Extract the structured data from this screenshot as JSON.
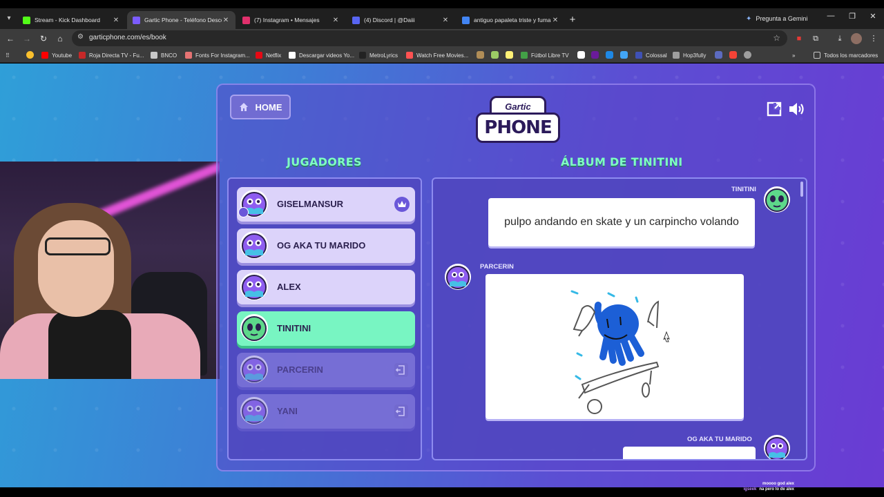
{
  "browser": {
    "tabs": [
      {
        "title": "Stream - Kick Dashboard",
        "icon": "kick-icon",
        "color": "#53fc18",
        "active": false
      },
      {
        "title": "Gartic Phone - Teléfono Descon",
        "icon": "gartic-icon",
        "color": "#7b5cff",
        "active": true
      },
      {
        "title": "(7) Instagram • Mensajes",
        "icon": "instagram-icon",
        "color": "#e1306c",
        "active": false
      },
      {
        "title": "(4) Discord | @Daiii",
        "icon": "discord-icon",
        "color": "#5865f2",
        "active": false
      },
      {
        "title": "antiguo papaleta triste y fuman",
        "icon": "google-icon",
        "color": "#4285f4",
        "active": false
      }
    ],
    "gemini_label": "Pregunta a Gemini",
    "url": "garticphone.com/es/book",
    "bookmarks": [
      {
        "label": "Youtube",
        "icon": "youtube-icon",
        "color": "#ff0000"
      },
      {
        "label": "Roja Directa TV - Fu...",
        "icon": "rojadirecta-icon",
        "color": "#c62828"
      },
      {
        "label": "BNCO",
        "icon": "folder-icon",
        "color": "#c8c8c8"
      },
      {
        "label": "Fonts For Instagram...",
        "icon": "fonts-icon",
        "color": "#e57373"
      },
      {
        "label": "Netflix",
        "icon": "netflix-icon",
        "color": "#e50914"
      },
      {
        "label": "Descargar videos Yo...",
        "icon": "download-icon",
        "color": "#ffffff"
      },
      {
        "label": "MetroLyrics",
        "icon": "metrolyrics-icon",
        "color": "#222222"
      },
      {
        "label": "Watch Free Movies...",
        "icon": "movies-icon",
        "color": "#ff5252"
      },
      {
        "label": "Fútbol Libre TV",
        "icon": "futbol-icon",
        "color": "#43a047"
      },
      {
        "label": "Colossal",
        "icon": "colossal-icon",
        "color": "#3f51b5"
      },
      {
        "label": "Hop3fully",
        "icon": "hop3fully-icon",
        "color": "#9e9e9e"
      }
    ],
    "all_bookmarks_label": "Todos los marcadores"
  },
  "game": {
    "home_label": "HOME",
    "logo_top": "Gartic",
    "logo_main": "PHONE",
    "players_title": "JUGADORES",
    "album_title": "ÁLBUM DE TINITINI",
    "players": [
      {
        "name": "GISELMANSUR",
        "state": "normal",
        "host": true,
        "avatar": "purple-bird-avatar"
      },
      {
        "name": "OG AKA TU MARIDO",
        "state": "normal",
        "host": false,
        "avatar": "purple-bird-avatar"
      },
      {
        "name": "ALEX",
        "state": "normal",
        "host": false,
        "avatar": "purple-bird-avatar"
      },
      {
        "name": "TINITINI",
        "state": "active",
        "host": false,
        "avatar": "green-alien-avatar"
      },
      {
        "name": "PARCERIN",
        "state": "gone",
        "host": false,
        "avatar": "purple-bird-avatar"
      },
      {
        "name": "YANI",
        "state": "gone",
        "host": false,
        "avatar": "purple-bird-avatar"
      }
    ],
    "album": {
      "first_author": "TINITINI",
      "first_text": "pulpo andando en skate y un carpincho volando",
      "second_author": "PARCERIN",
      "third_author": "OG AKA TU MARIDO"
    }
  },
  "chat": [
    {
      "nick": "",
      "text": "moooo god alex"
    },
    {
      "nick": "igseek",
      "text": "na pero lo de alex"
    }
  ]
}
